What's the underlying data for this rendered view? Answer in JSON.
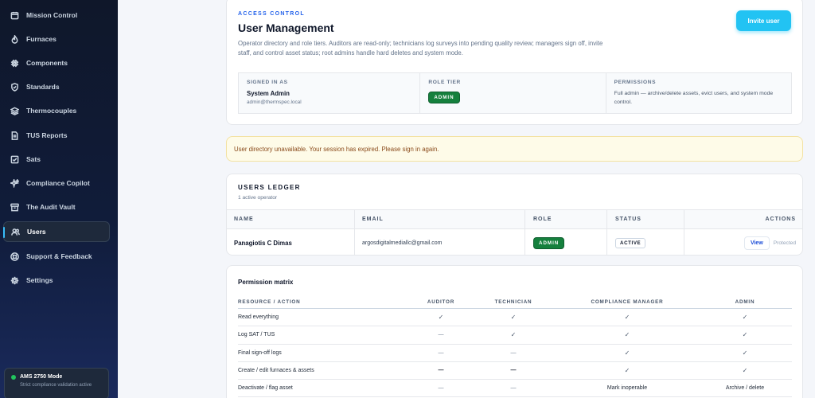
{
  "sidebar": {
    "items": [
      {
        "label": "Mission Control",
        "icon": "calendar-icon"
      },
      {
        "label": "Furnaces",
        "icon": "flame-icon"
      },
      {
        "label": "Components",
        "icon": "chip-icon"
      },
      {
        "label": "Standards",
        "icon": "shield-icon"
      },
      {
        "label": "Thermocouples",
        "icon": "layers-icon"
      },
      {
        "label": "TUS Reports",
        "icon": "document-icon"
      },
      {
        "label": "Sats",
        "icon": "checklist-icon"
      },
      {
        "label": "Compliance Copilot",
        "icon": "sparkle-icon"
      },
      {
        "label": "The Audit Vault",
        "icon": "archive-icon"
      },
      {
        "label": "Users",
        "icon": "users-icon"
      },
      {
        "label": "Support & Feedback",
        "icon": "help-icon"
      },
      {
        "label": "Settings",
        "icon": "gear-icon"
      }
    ],
    "active": "Users",
    "mode": {
      "title": "AMS 2750 Mode",
      "subtitle": "Strict compliance validation active",
      "status_color": "#22c55e"
    }
  },
  "header": {
    "eyebrow": "ACCESS CONTROL",
    "title": "User Management",
    "description": "Operator directory and role tiers. Auditors are read-only; technicians log surveys into pending quality review; managers sign off, invite staff, and control asset status; root admins handle hard deletes and system mode.",
    "invite_label": "Invite user",
    "signed_in_label": "SIGNED IN AS",
    "signed_in_name": "System Admin",
    "signed_in_email": "admin@thermspec.local",
    "role_tier_label": "ROLE TIER",
    "role_tier_value": "ADMIN",
    "permissions_label": "PERMISSIONS",
    "permissions_text": "Full admin — archive/delete assets, evict users, and system mode control."
  },
  "alert": {
    "text": "User directory unavailable. Your session has expired. Please sign in again."
  },
  "ledger": {
    "title": "USERS LEDGER",
    "subtitle": "1 active operator",
    "columns": [
      "NAME",
      "EMAIL",
      "ROLE",
      "STATUS",
      "ACTIONS"
    ],
    "rows": [
      {
        "name": "Panagiotis C Dimas",
        "email": "argosdigitalmediallc@gmail.com",
        "role": "ADMIN",
        "status": "ACTIVE",
        "action": "View",
        "note": "Protected"
      }
    ]
  },
  "matrix": {
    "title": "Permission matrix",
    "columns": [
      "RESOURCE / ACTION",
      "AUDITOR",
      "TECHNICIAN",
      "COMPLIANCE MANAGER",
      "ADMIN"
    ],
    "rows": [
      [
        "Read everything",
        "✓",
        "✓",
        "✓",
        "✓"
      ],
      [
        "Log SAT / TUS",
        "—",
        "✓",
        "✓",
        "✓"
      ],
      [
        "Final sign-off logs",
        "—",
        "—",
        "✓",
        "✓"
      ],
      [
        "Create / edit furnaces & assets",
        "—",
        "—",
        "✓",
        "✓"
      ],
      [
        "Deactivate / flag asset",
        "—",
        "—",
        "Mark inoperable",
        "Archive / delete"
      ]
    ]
  },
  "colors": {
    "accent": "#22c3f3",
    "badge": "#15803d",
    "sidebar": "#0f172a",
    "eyebrow": "#2563eb"
  }
}
